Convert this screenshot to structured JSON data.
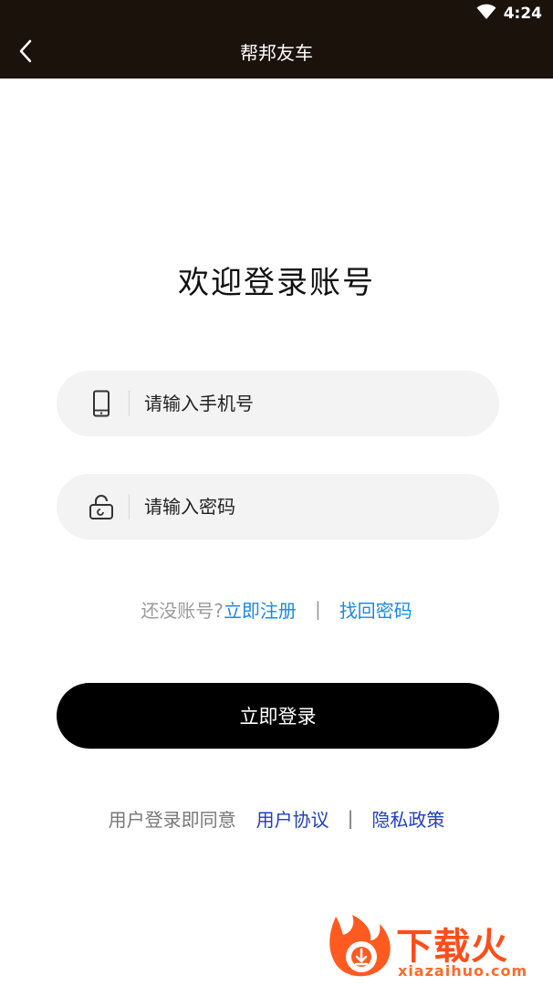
{
  "status_bar": {
    "time": "4:24",
    "wifi_icon": "wifi-icon"
  },
  "app_bar": {
    "back_icon": "chevron-left-icon",
    "title": "帮邦友车"
  },
  "login": {
    "welcome": "欢迎登录账号",
    "phone": {
      "icon": "phone-icon",
      "placeholder": "请输入手机号",
      "value": ""
    },
    "password": {
      "icon": "lock-icon",
      "placeholder": "请输入密码",
      "value": ""
    },
    "no_account_text": "还没账号?",
    "register_link": "立即注册",
    "separator": "|",
    "forgot_link": "找回密码",
    "login_button": "立即登录",
    "agree_text": "用户登录即同意",
    "user_agreement": "用户协议",
    "privacy_policy": "隐私政策"
  },
  "watermark": {
    "title": "下载火",
    "url": "xiazaihuo.com"
  },
  "colors": {
    "app_bar": "#1b120c",
    "link_blue": "#1e88e5",
    "agreement_blue": "#1f3fbf",
    "button_black": "#000000",
    "field_bg": "#f3f3f3",
    "watermark_orange": "#ff4e1a"
  }
}
